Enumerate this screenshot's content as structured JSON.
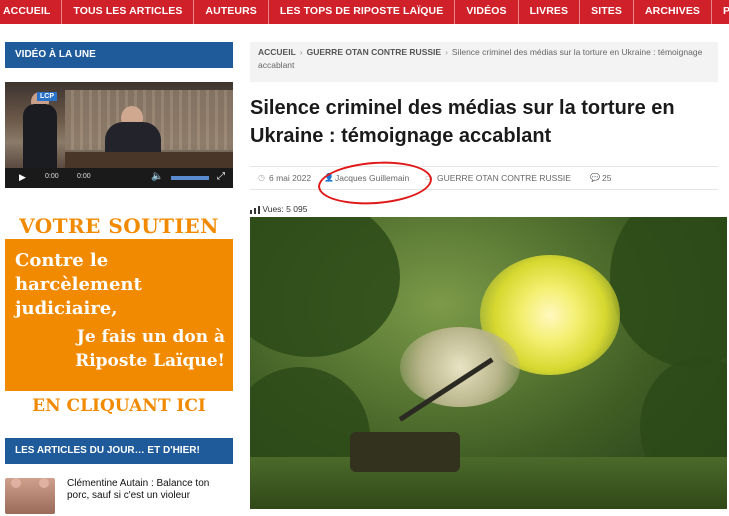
{
  "nav": {
    "items": [
      "ACCUEIL",
      "TOUS LES ARTICLES",
      "AUTEURS",
      "LES TOPS DE RIPOSTE LAÏQUE",
      "VIDÉOS",
      "LIVRES",
      "SITES",
      "ARCHIVES",
      "P"
    ]
  },
  "sidebar": {
    "video_heading": "VIDÉO À LA UNE",
    "video": {
      "channel_logo": "LCP",
      "time_current": "0:00",
      "time_total": "0:00"
    },
    "support": {
      "title": "VOTRE SOUTIEN",
      "line1": "Contre le harcèlement judiciaire,",
      "line2": "Je fais un don à Riposte Laïque!",
      "cta": "EN CLIQUANT ICI"
    },
    "articles_heading": "LES ARTICLES DU JOUR… ET D'HIER!",
    "articles": [
      {
        "title": "Clémentine Autain : Balance ton porc, sauf si c'est un violeur"
      }
    ]
  },
  "article": {
    "breadcrumb": {
      "home": "ACCUEIL",
      "category": "GUERRE OTAN CONTRE RUSSIE",
      "current": "Silence criminel des médias sur la torture en Ukraine : témoignage accablant"
    },
    "title": "Silence criminel des médias sur la torture en Ukraine : témoignage accablant",
    "meta": {
      "date": "6 mai 2022",
      "author": "Jacques Guillemain",
      "category": "GUERRE OTAN CONTRE RUSSIE",
      "comments": "25"
    },
    "views": "Vues: 5 095"
  },
  "colors": {
    "nav_red": "#d0202a",
    "sidebar_blue": "#1f5b9b",
    "support_orange": "#f28a00",
    "annotation_red": "#e01818"
  }
}
